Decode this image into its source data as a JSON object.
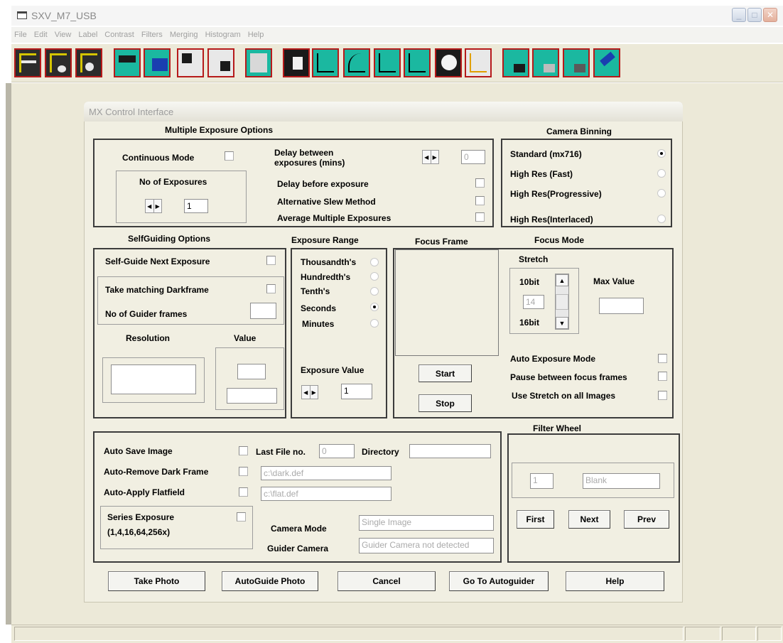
{
  "window": {
    "title": "SXV_M7_USB",
    "menu": [
      "File",
      "Edit",
      "View",
      "Label",
      "Contrast",
      "Filters",
      "Merging",
      "Histogram",
      "Help"
    ]
  },
  "toolbar": {
    "buttons": [
      "camera-fits-icon",
      "camera-fits-alt-icon",
      "camera-frame-icon",
      "cable-icon",
      "monitor-icon",
      "transfer-left-icon",
      "transfer-right-icon",
      "list-icon",
      "text-icon",
      "histogram-left-icon",
      "curve-icon",
      "linear-icon",
      "histogram-right-icon",
      "equator-icon",
      "peak-icon",
      "minus-icon",
      "multiply-icon",
      "plus-icon",
      "telescope-icon"
    ]
  },
  "dialog": {
    "title": "MX Control Interface",
    "multiple_exposure": {
      "heading": "Multiple Exposure Options",
      "continuous_mode": "Continuous Mode",
      "no_of_exposures": "No of Exposures",
      "no_of_exposures_value": "1",
      "delay_between": "Delay between",
      "delay_between_2": "exposures (mins)",
      "delay_value": "0",
      "delay_before": "Delay before exposure",
      "alt_slew": "Alternative Slew Method",
      "average_multiple": "Average Multiple Exposures"
    },
    "camera_binning": {
      "heading": "Camera Binning",
      "options": [
        "Standard (mx716)",
        "High Res (Fast)",
        "High Res(Progressive)",
        "High Res(Interlaced)"
      ],
      "selected": "Standard (mx716)"
    },
    "selfguiding": {
      "heading": "SelfGuiding Options",
      "self_guide_next": "Self-Guide Next Exposure",
      "take_matching": "Take matching Darkframe",
      "no_guider_frames": "No of Guider frames",
      "resolution": "Resolution",
      "value": "Value"
    },
    "exposure_range": {
      "heading": "Exposure Range",
      "options": [
        "Thousandth's",
        "Hundredth's",
        "Tenth's",
        "Seconds",
        "Minutes"
      ],
      "selected": "Seconds",
      "exposure_value_label": "Exposure Value",
      "exposure_value": "1"
    },
    "focus_frame": {
      "heading": "Focus Frame",
      "start": "Start",
      "stop": "Stop"
    },
    "focus_mode": {
      "heading": "Focus Mode",
      "stretch": "Stretch",
      "bit10": "10bit",
      "bit16": "16bit",
      "stretch_value": "14",
      "max_value": "Max Value",
      "auto_exposure": "Auto Exposure Mode",
      "pause_between": "Pause between focus frames",
      "use_stretch": "Use Stretch on all Images"
    },
    "save": {
      "auto_save": "Auto Save Image",
      "last_file_no": "Last File no.",
      "last_file_value": "0",
      "directory": "Directory",
      "auto_remove_dark": "Auto-Remove Dark Frame",
      "dark_path": "c:\\dark.def",
      "auto_apply_flat": "Auto-Apply Flatfield",
      "flat_path": "c:\\flat.def",
      "series_exposure": "Series Exposure",
      "series_values": "(1,4,16,64,256x)",
      "camera_mode": "Camera Mode",
      "camera_mode_value": "Single Image",
      "guider_camera": "Guider Camera",
      "guider_camera_value": "Guider Camera not detected"
    },
    "filter_wheel": {
      "heading": "Filter Wheel",
      "position": "1",
      "filter_name": "Blank",
      "first": "First",
      "next": "Next",
      "prev": "Prev"
    },
    "buttons": {
      "take_photo": "Take Photo",
      "autoguide_photo": "AutoGuide Photo",
      "cancel": "Cancel",
      "go_to_autoguider": "Go To Autoguider",
      "help": "Help"
    }
  }
}
